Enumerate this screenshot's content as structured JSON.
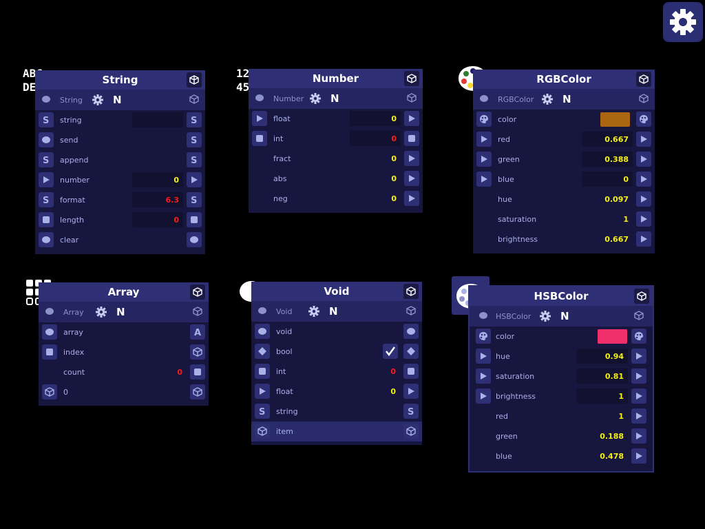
{
  "colors": {
    "background": "#000000",
    "panel": "#17163f",
    "title_bar": "#2e2f74",
    "value_yellow": "#f4f10e",
    "value_red": "#ff1a1a",
    "rgb_swatch": "#aa6611",
    "hsb_swatch": "#f0306a"
  },
  "nodes": {
    "string": {
      "title": "String",
      "sub_label": "String",
      "n": "N",
      "rows": [
        {
          "label": "string",
          "value": ""
        },
        {
          "label": "send",
          "value": ""
        },
        {
          "label": "append",
          "value": ""
        },
        {
          "label": "number",
          "value": "0"
        },
        {
          "label": "format",
          "value": "6.3"
        },
        {
          "label": "length",
          "value": "0"
        },
        {
          "label": "clear",
          "value": ""
        }
      ]
    },
    "number": {
      "title": "Number",
      "sub_label": "Number",
      "n": "N",
      "rows": [
        {
          "label": "float",
          "value": "0"
        },
        {
          "label": "int",
          "value": "0"
        },
        {
          "label": "fract",
          "value": "0"
        },
        {
          "label": "abs",
          "value": "0"
        },
        {
          "label": "neg",
          "value": "0"
        }
      ]
    },
    "rgbcolor": {
      "title": "RGBColor",
      "sub_label": "RGBColor",
      "n": "N",
      "rows": [
        {
          "label": "color",
          "value": ""
        },
        {
          "label": "red",
          "value": "0.667"
        },
        {
          "label": "green",
          "value": "0.388"
        },
        {
          "label": "blue",
          "value": "0"
        },
        {
          "label": "hue",
          "value": "0.097"
        },
        {
          "label": "saturation",
          "value": "1"
        },
        {
          "label": "brightness",
          "value": "0.667"
        }
      ]
    },
    "array": {
      "title": "Array",
      "sub_label": "Array",
      "n": "N",
      "rows": [
        {
          "label": "array",
          "value": ""
        },
        {
          "label": "index",
          "value": ""
        },
        {
          "label": "count",
          "value": "0"
        },
        {
          "label": "0",
          "value": ""
        }
      ]
    },
    "void": {
      "title": "Void",
      "sub_label": "Void",
      "n": "N",
      "rows": [
        {
          "label": "void",
          "value": ""
        },
        {
          "label": "bool",
          "value": ""
        },
        {
          "label": "int",
          "value": "0"
        },
        {
          "label": "float",
          "value": "0"
        },
        {
          "label": "string",
          "value": ""
        },
        {
          "label": "item",
          "value": ""
        }
      ]
    },
    "hsbcolor": {
      "title": "HSBColor",
      "sub_label": "HSBColor",
      "n": "N",
      "rows": [
        {
          "label": "color",
          "value": ""
        },
        {
          "label": "hue",
          "value": "0.94"
        },
        {
          "label": "saturation",
          "value": "0.81"
        },
        {
          "label": "brightness",
          "value": "1"
        },
        {
          "label": "red",
          "value": "1"
        },
        {
          "label": "green",
          "value": "0.188"
        },
        {
          "label": "blue",
          "value": "0.478"
        }
      ]
    }
  },
  "icons": {
    "string_node": "abc-def-icon",
    "number_node": "123-456-icon",
    "rgb_node": "palette-icon",
    "array_node": "grid-icon",
    "void_node": "circle-icon",
    "hsb_node": "palette-icon",
    "settings": "gear-icon"
  }
}
